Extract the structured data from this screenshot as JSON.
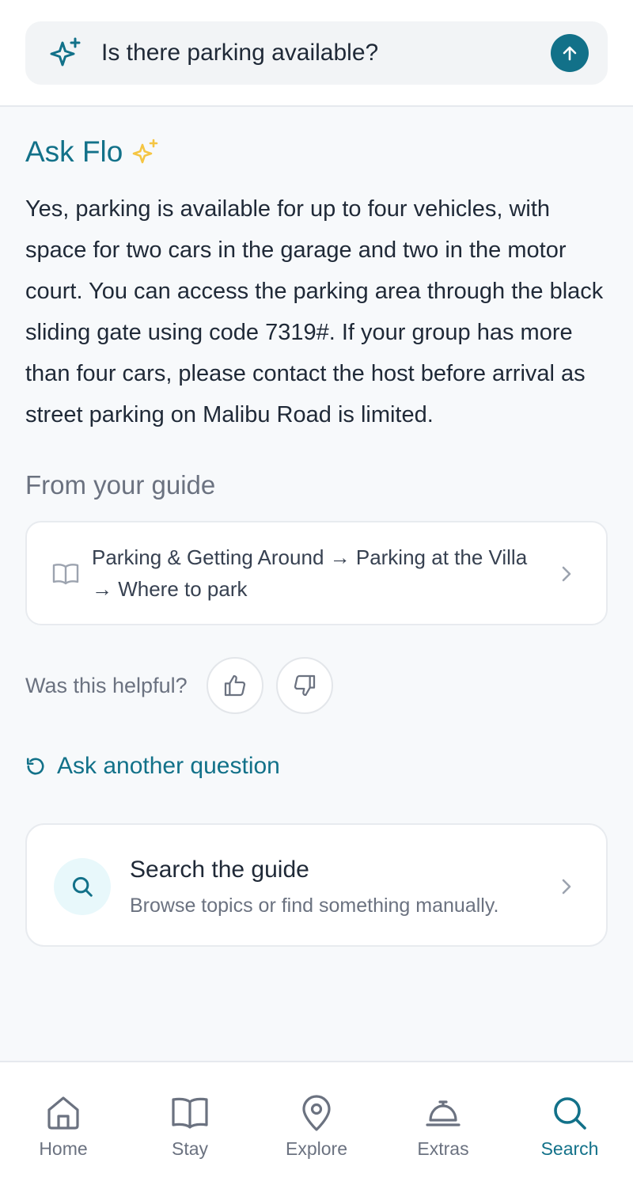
{
  "search": {
    "query": "Is there parking available?",
    "submit_icon": "arrow-up-icon"
  },
  "answer": {
    "title": "Ask Flo",
    "text": "Yes, parking is available for up to four vehicles, with space for two cars in the garage and two in the motor court. You can access the parking area through the black sliding gate using code 7319#. If your group has more than four cars, please contact the host before arrival as street parking on Malibu Road is limited."
  },
  "guide": {
    "heading": "From your guide",
    "source_path": "Parking & Getting Around → Parking at the Villa → Where to park"
  },
  "feedback": {
    "label": "Was this helpful?"
  },
  "ask_another": {
    "label": "Ask another question"
  },
  "search_card": {
    "title": "Search the guide",
    "subtitle": "Browse topics or find something manually."
  },
  "nav": {
    "items": [
      {
        "label": "Home",
        "icon": "home-icon"
      },
      {
        "label": "Stay",
        "icon": "book-icon"
      },
      {
        "label": "Explore",
        "icon": "map-pin-icon"
      },
      {
        "label": "Extras",
        "icon": "service-bell-icon"
      },
      {
        "label": "Search",
        "icon": "search-icon"
      }
    ],
    "active": "Search"
  },
  "colors": {
    "accent": "#127189",
    "sparkle": "#f5c542",
    "background": "#f7f9fb",
    "muted_text": "#6b7280"
  }
}
